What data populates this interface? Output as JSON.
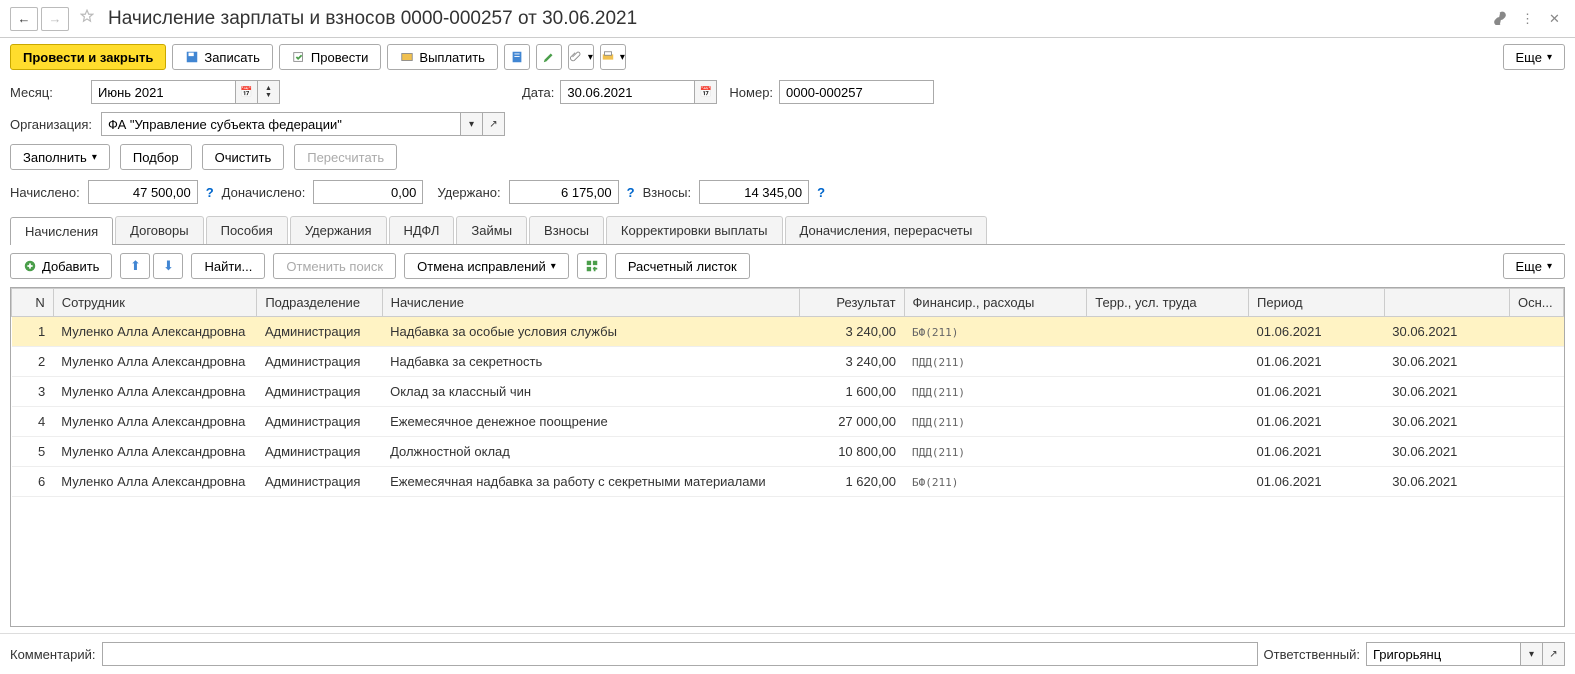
{
  "title": "Начисление зарплаты и взносов 0000-000257 от 30.06.2021",
  "toolbar": {
    "post_close": "Провести и закрыть",
    "save": "Записать",
    "post": "Провести",
    "pay": "Выплатить",
    "more": "Еще"
  },
  "form": {
    "month_label": "Месяц:",
    "month_value": "Июнь 2021",
    "date_label": "Дата:",
    "date_value": "30.06.2021",
    "number_label": "Номер:",
    "number_value": "0000-000257",
    "org_label": "Организация:",
    "org_value": "ФА \"Управление субъекта федерации\""
  },
  "actions": {
    "fill": "Заполнить",
    "pick": "Подбор",
    "clear": "Очистить",
    "recalc": "Пересчитать"
  },
  "summary": {
    "accrued_label": "Начислено:",
    "accrued": "47 500,00",
    "extra_label": "Доначислено:",
    "extra": "0,00",
    "withheld_label": "Удержано:",
    "withheld": "6 175,00",
    "contrib_label": "Взносы:",
    "contrib": "14 345,00"
  },
  "tabs": [
    "Начисления",
    "Договоры",
    "Пособия",
    "Удержания",
    "НДФЛ",
    "Займы",
    "Взносы",
    "Корректировки выплаты",
    "Доначисления, перерасчеты"
  ],
  "tab_toolbar": {
    "add": "Добавить",
    "find": "Найти...",
    "cancel_search": "Отменить поиск",
    "cancel_fix": "Отмена исправлений",
    "payslip": "Расчетный листок",
    "more": "Еще"
  },
  "columns": {
    "n": "N",
    "emp": "Сотрудник",
    "dept": "Подразделение",
    "acc": "Начисление",
    "res": "Результат",
    "fin": "Финансир., расходы",
    "terr": "Терр., усл. труда",
    "per": "Период",
    "osn": "Осн..."
  },
  "rows": [
    {
      "n": "1",
      "emp": "Муленко Алла Александровна",
      "dept": "Администрация",
      "acc": "Надбавка за особые условия службы",
      "res": "3 240,00",
      "fin": "БФ(211)",
      "p1": "01.06.2021",
      "p2": "30.06.2021"
    },
    {
      "n": "2",
      "emp": "Муленко Алла Александровна",
      "dept": "Администрация",
      "acc": "Надбавка за секретность",
      "res": "3 240,00",
      "fin": "ПДД(211)",
      "p1": "01.06.2021",
      "p2": "30.06.2021"
    },
    {
      "n": "3",
      "emp": "Муленко Алла Александровна",
      "dept": "Администрация",
      "acc": "Оклад за классный чин",
      "res": "1 600,00",
      "fin": "ПДД(211)",
      "p1": "01.06.2021",
      "p2": "30.06.2021"
    },
    {
      "n": "4",
      "emp": "Муленко Алла Александровна",
      "dept": "Администрация",
      "acc": "Ежемесячное денежное поощрение",
      "res": "27 000,00",
      "fin": "ПДД(211)",
      "p1": "01.06.2021",
      "p2": "30.06.2021"
    },
    {
      "n": "5",
      "emp": "Муленко Алла Александровна",
      "dept": "Администрация",
      "acc": "Должностной оклад",
      "res": "10 800,00",
      "fin": "ПДД(211)",
      "p1": "01.06.2021",
      "p2": "30.06.2021"
    },
    {
      "n": "6",
      "emp": "Муленко Алла Александровна",
      "dept": "Администрация",
      "acc": "Ежемесячная надбавка за работу с секретными материалами",
      "res": "1 620,00",
      "fin": "БФ(211)",
      "p1": "01.06.2021",
      "p2": "30.06.2021"
    }
  ],
  "footer": {
    "comment_label": "Комментарий:",
    "resp_label": "Ответственный:",
    "resp_value": "Григорьянц"
  }
}
